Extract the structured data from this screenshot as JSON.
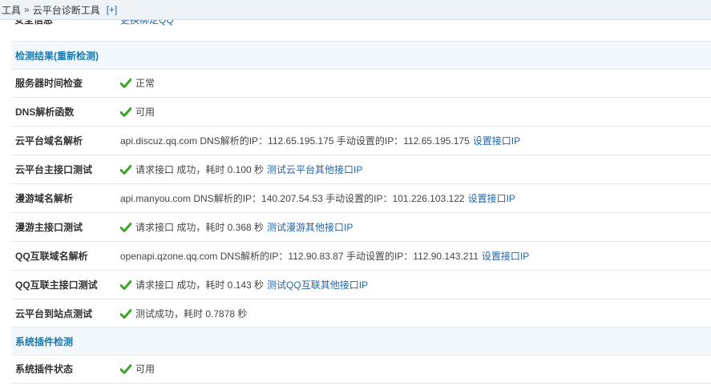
{
  "header": {
    "crumb_tools": "工具",
    "crumb_sep": "»",
    "crumb_page": "云平台诊断工具",
    "add_link": "[+]"
  },
  "clipped_row": {
    "label": "安全信息",
    "value": "更换绑定QQ"
  },
  "sections": {
    "detect": "检测结果(重新检测)",
    "plugin": "系统插件检测"
  },
  "rows": {
    "server_time": {
      "label": "服务器时间检查",
      "text": "正常"
    },
    "dns_func": {
      "label": "DNS解析函数",
      "text": "可用"
    },
    "cloud_domain": {
      "label": "云平台域名解析",
      "text": "api.discuz.qq.com DNS解析的IP：112.65.195.175 手动设置的IP：112.65.195.175",
      "link": "设置接口IP"
    },
    "cloud_api": {
      "label": "云平台主接口测试",
      "text": "请求接口 成功，耗时 0.100 秒",
      "link": "测试云平台其他接口IP"
    },
    "manyou_domain": {
      "label": "漫游域名解析",
      "text": "api.manyou.com DNS解析的IP：140.207.54.53 手动设置的IP：101.226.103.122",
      "link": "设置接口IP"
    },
    "manyou_api": {
      "label": "漫游主接口测试",
      "text": "请求接口 成功，耗时 0.368 秒",
      "link": "测试漫游其他接口IP"
    },
    "qq_domain": {
      "label": "QQ互联域名解析",
      "text": "openapi.qzone.qq.com DNS解析的IP：112.90.83.87 手动设置的IP：112.90.143.211",
      "link": "设置接口IP"
    },
    "qq_api": {
      "label": "QQ互联主接口测试",
      "text": "请求接口 成功，耗时 0.143 秒",
      "link": "测试QQ互联其他接口IP"
    },
    "cloud_site": {
      "label": "云平台到站点测试",
      "text": "测试成功，耗时 0.7878 秒"
    },
    "plugin_status": {
      "label": "系统插件状态",
      "text": "可用"
    }
  },
  "colors": {
    "success": "#3fa32b",
    "link": "#2366a8",
    "section_title": "#1b79ad"
  }
}
